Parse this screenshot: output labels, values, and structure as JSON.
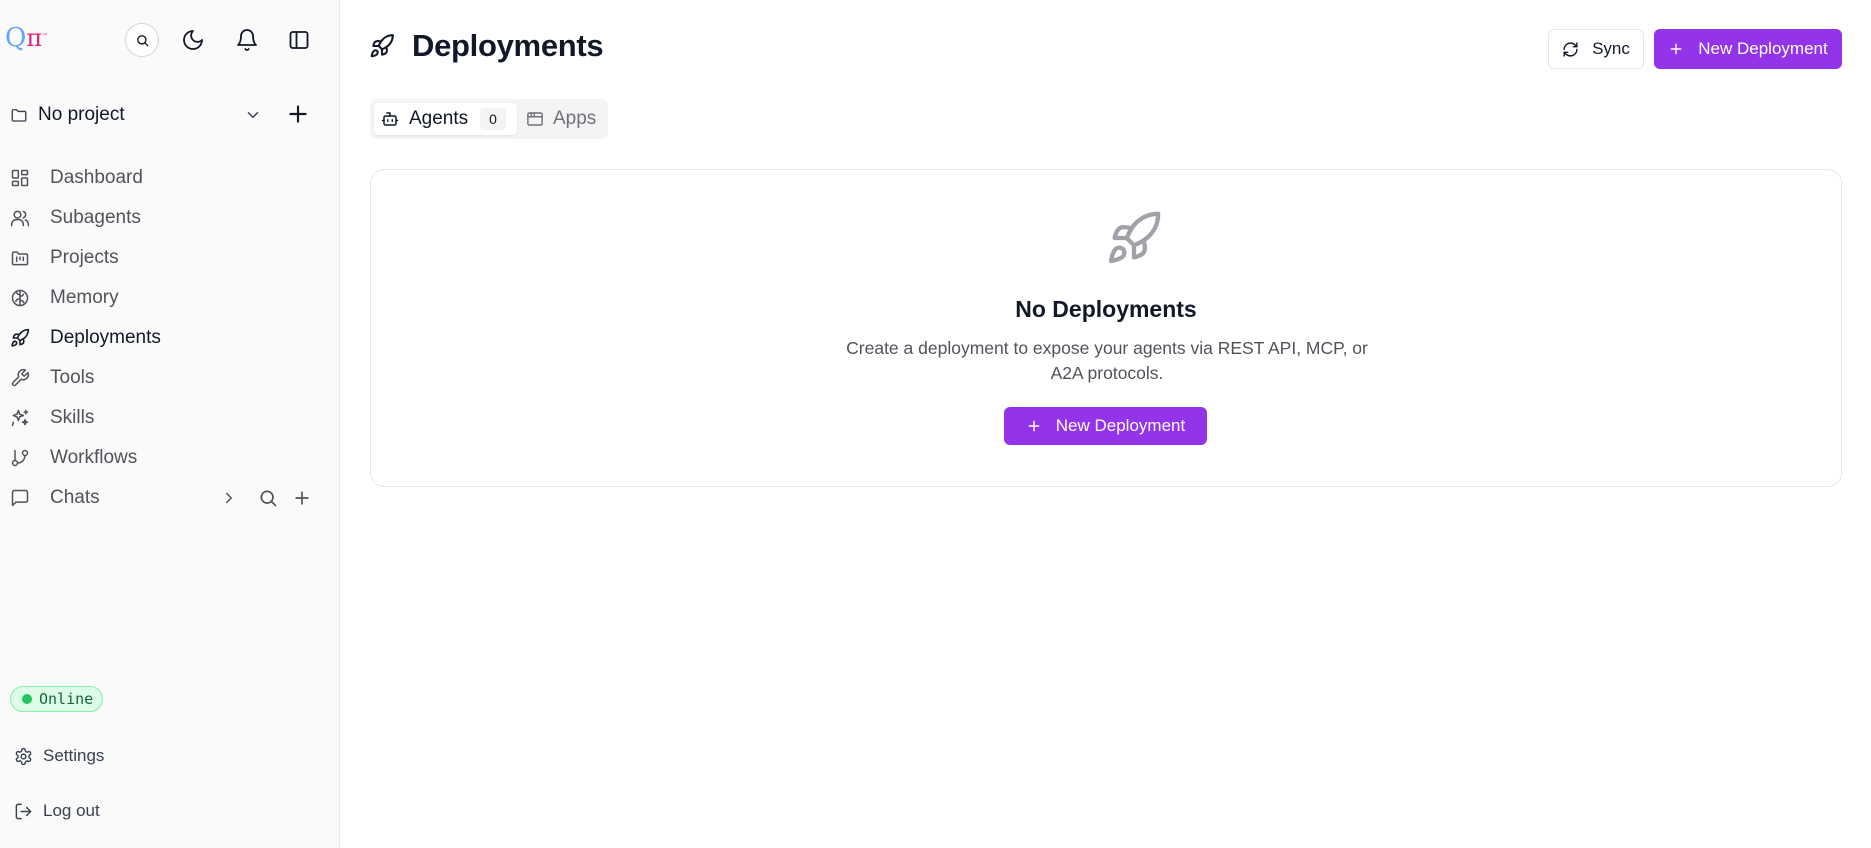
{
  "sidebar": {
    "logo": {
      "main": "Q",
      "pi": "π",
      "sup": "™"
    },
    "top_icons": [
      "search-icon",
      "moon-icon",
      "bell-icon",
      "panel-left-icon"
    ],
    "project": {
      "label": "No project"
    },
    "nav": [
      {
        "label": "Dashboard",
        "icon": "dashboard-icon",
        "active": false
      },
      {
        "label": "Subagents",
        "icon": "users-icon",
        "active": false
      },
      {
        "label": "Projects",
        "icon": "folder-kanban-icon",
        "active": false
      },
      {
        "label": "Memory",
        "icon": "brain-icon",
        "active": false
      },
      {
        "label": "Deployments",
        "icon": "rocket-icon",
        "active": true
      },
      {
        "label": "Tools",
        "icon": "wrench-icon",
        "active": false
      },
      {
        "label": "Skills",
        "icon": "sparkles-icon",
        "active": false
      },
      {
        "label": "Workflows",
        "icon": "git-branch-icon",
        "active": false
      },
      {
        "label": "Chats",
        "icon": "message-square-icon",
        "active": false
      }
    ],
    "status": {
      "label": "Online",
      "color": "#22c55e"
    },
    "footer": {
      "settings": "Settings",
      "logout": "Log out"
    }
  },
  "header": {
    "title": "Deployments",
    "sync_label": "Sync",
    "new_label": "New Deployment"
  },
  "tabs": {
    "agents": {
      "label": "Agents",
      "count": "0"
    },
    "apps": {
      "label": "Apps"
    }
  },
  "empty_state": {
    "title": "No Deployments",
    "description": "Create a deployment to expose your agents via REST API, MCP, or A2A protocols.",
    "button_label": "New Deployment"
  },
  "colors": {
    "accent": "#9333ea",
    "sidebar_bg": "#fafafa",
    "status_bg": "#dcfce7"
  }
}
